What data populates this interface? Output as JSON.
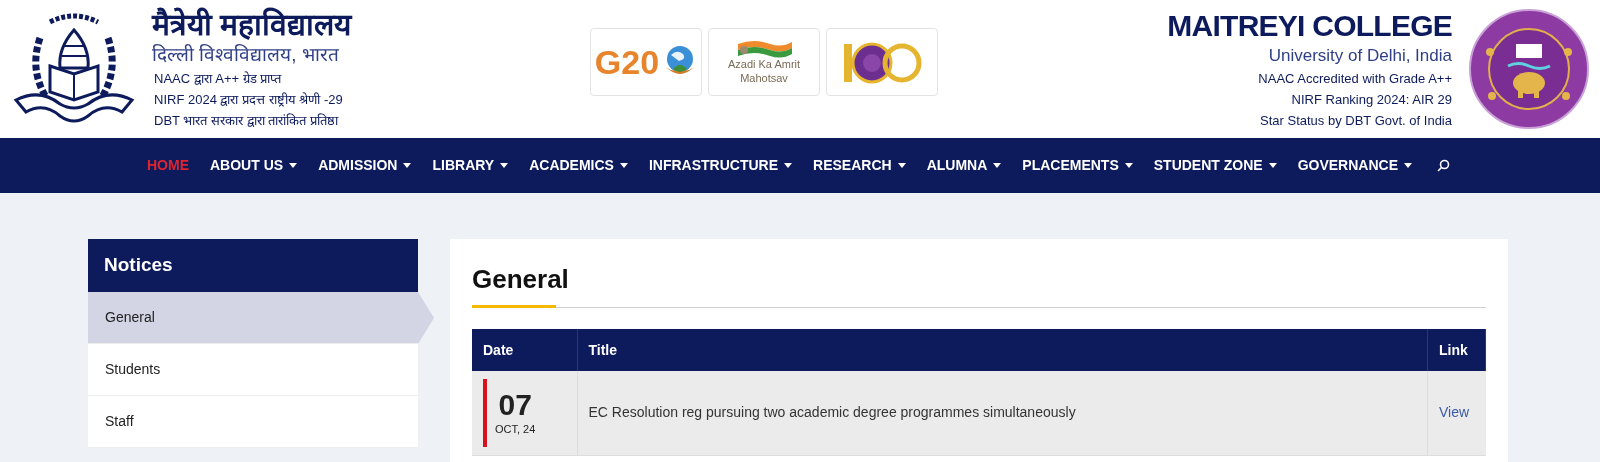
{
  "header": {
    "hindi_title": "मैत्रेयी महाविद्यालय",
    "hindi_subtitle": "दिल्ली विश्वविद्यालय, भारत",
    "hindi_lines": [
      "NAAC द्वारा A++ ग्रेड प्राप्त",
      "NIRF 2024 द्वारा प्रदत्त राष्ट्रीय श्रेणी -29",
      "DBT भारत सरकार द्वारा तारांकित प्रतिष्ठा"
    ],
    "badges": [
      {
        "kind": "g20",
        "text": "G20"
      },
      {
        "kind": "azadi",
        "text": "Azadi Ka Amrit Mahotsav"
      },
      {
        "kind": "centenary"
      }
    ],
    "english_title": "MAITREYI COLLEGE",
    "english_subtitle": "University of Delhi, India",
    "english_lines": [
      "NAAC Accredited with Grade A++",
      "NIRF Ranking 2024: AIR 29",
      "Star Status by DBT Govt. of India"
    ]
  },
  "nav": {
    "items": [
      {
        "label": "HOME",
        "selected": true,
        "dropdown": false
      },
      {
        "label": "ABOUT US",
        "selected": false,
        "dropdown": true
      },
      {
        "label": "ADMISSION",
        "selected": false,
        "dropdown": true
      },
      {
        "label": "LIBRARY",
        "selected": false,
        "dropdown": true
      },
      {
        "label": "ACADEMICS",
        "selected": false,
        "dropdown": true
      },
      {
        "label": "INFRASTRUCTURE",
        "selected": false,
        "dropdown": true
      },
      {
        "label": "RESEARCH",
        "selected": false,
        "dropdown": true
      },
      {
        "label": "ALUMNA",
        "selected": false,
        "dropdown": true
      },
      {
        "label": "PLACEMENTS",
        "selected": false,
        "dropdown": true
      },
      {
        "label": "STUDENT ZONE",
        "selected": false,
        "dropdown": true
      },
      {
        "label": "GOVERNANCE",
        "selected": false,
        "dropdown": true
      }
    ]
  },
  "sidebar": {
    "title": "Notices",
    "items": [
      {
        "label": "General",
        "selected": true
      },
      {
        "label": "Students",
        "selected": false
      },
      {
        "label": "Staff",
        "selected": false
      }
    ]
  },
  "content": {
    "title": "General",
    "table": {
      "columns": [
        "Date",
        "Title",
        "Link"
      ],
      "rows": [
        {
          "day": "07",
          "month_year": "OCT, 24",
          "title": "EC Resolution reg pursuing two academic degree programmes simultaneously",
          "link": "View"
        }
      ]
    }
  }
}
